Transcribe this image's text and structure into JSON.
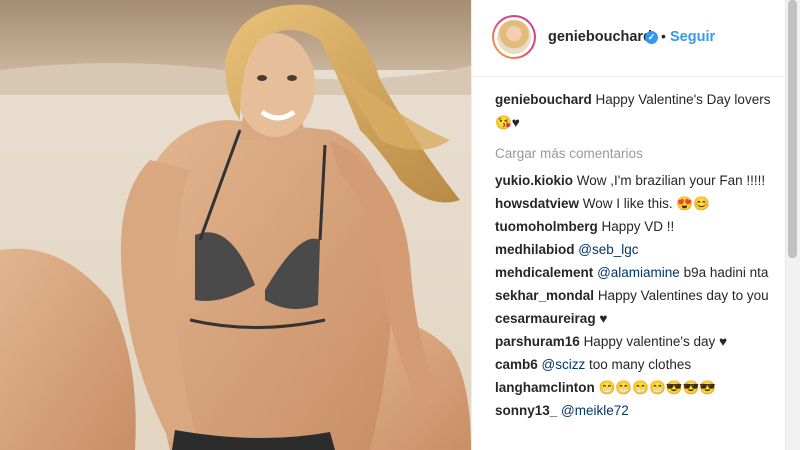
{
  "post": {
    "username": "geniebouchard",
    "verified_icon": "verified-badge-icon",
    "separator": "•",
    "follow_label": "Seguir",
    "caption_user": "geniebouchard",
    "caption_text": "Happy Valentine's Day lovers 😘♥",
    "load_more": "Cargar más comentarios"
  },
  "comments": [
    {
      "user": "yukio.kiokio",
      "mention": "",
      "text": "Wow ,I'm brazilian your Fan !!!!!"
    },
    {
      "user": "howsdatview",
      "mention": "",
      "text": "Wow I like this. 😍😊"
    },
    {
      "user": "tuomoholmberg",
      "mention": "",
      "text": "Happy VD !!"
    },
    {
      "user": "medhilabiod",
      "mention": "@seb_lgc",
      "text": ""
    },
    {
      "user": "mehdicalement",
      "mention": "@alamiamine",
      "text": "b9a hadini nta"
    },
    {
      "user": "sekhar_mondal",
      "mention": "",
      "text": "Happy Valentines day to you"
    },
    {
      "user": "cesarmaureirag",
      "mention": "",
      "text": "♥"
    },
    {
      "user": "parshuram16",
      "mention": "",
      "text": "Happy valentine's day ♥"
    },
    {
      "user": "camb6",
      "mention": "@scizz",
      "text": "too many clothes"
    },
    {
      "user": "langhamclinton",
      "mention": "",
      "text": "😁😁😁😁😎😎😎"
    },
    {
      "user": "sonny13_",
      "mention": "@meikle72",
      "text": ""
    }
  ],
  "colors": {
    "accent": "#3897f0",
    "text": "#262626",
    "muted": "#999999",
    "mention": "#003569"
  }
}
